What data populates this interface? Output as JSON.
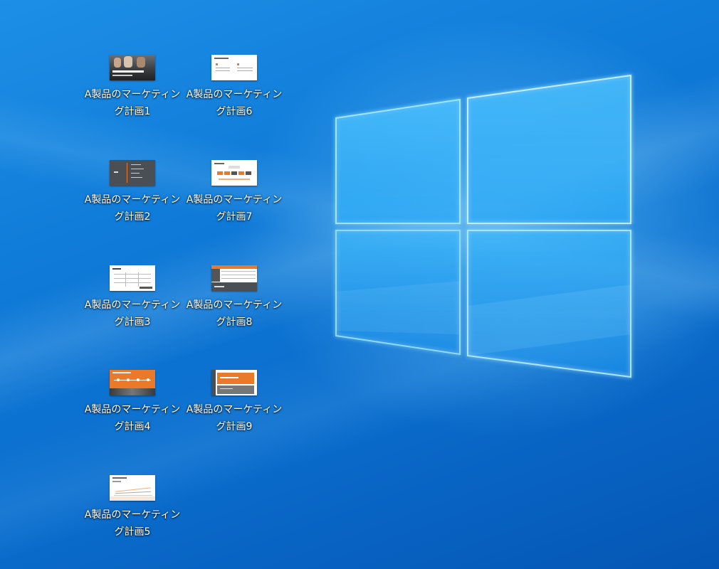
{
  "desktop": {
    "icons": [
      {
        "line1": "A製品のマーケティン",
        "line2": "グ計画1",
        "thumbnail": "photo-people-slide"
      },
      {
        "line1": "A製品のマーケティン",
        "line2": "グ計画6",
        "thumbnail": "white-text-slide"
      },
      {
        "line1": "A製品のマーケティン",
        "line2": "グ計画2",
        "thumbnail": "dark-agenda-slide"
      },
      {
        "line1": "A製品のマーケティン",
        "line2": "グ計画7",
        "thumbnail": "orange-boxes-slide"
      },
      {
        "line1": "A製品のマーケティン",
        "line2": "グ計画3",
        "thumbnail": "white-table-slide"
      },
      {
        "line1": "A製品のマーケティン",
        "line2": "グ計画8",
        "thumbnail": "orange-table-slide"
      },
      {
        "line1": "A製品のマーケティン",
        "line2": "グ計画4",
        "thumbnail": "orange-timeline-slide"
      },
      {
        "line1": "A製品のマーケティン",
        "line2": "グ計画9",
        "thumbnail": "orange-title-slide"
      },
      {
        "line1": "A製品のマーケティン",
        "line2": "グ計画5",
        "thumbnail": "white-chart-slide"
      }
    ]
  },
  "wallpaper": {
    "name": "windows-logo-wallpaper",
    "base_color": "#0f7ad8",
    "glow_color": "#8fdcff"
  },
  "colors": {
    "accent_orange": "#ea7a2a",
    "slide_dark": "#4a4f55"
  }
}
